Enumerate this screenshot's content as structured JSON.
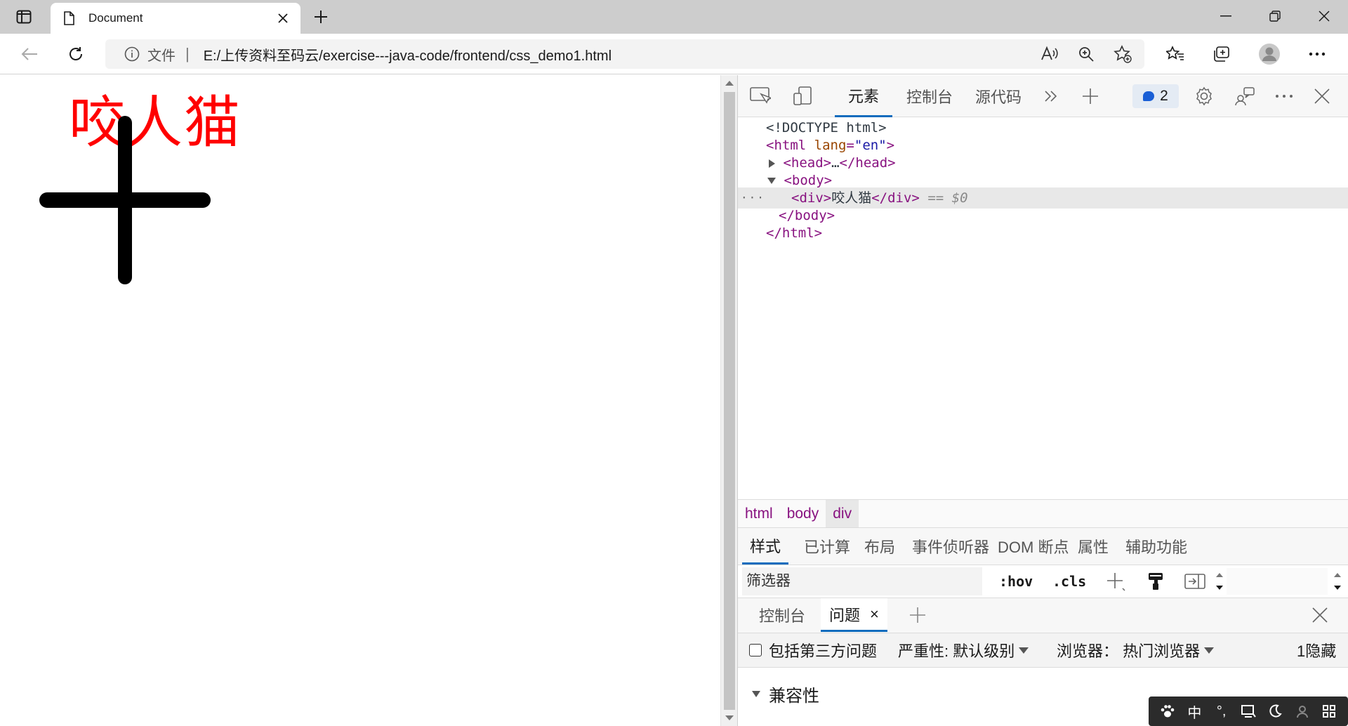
{
  "browser": {
    "tab_title": "Document",
    "address": {
      "info_label": "文件",
      "separator": "|",
      "url": "E:/上传资料至码云/exercise---java-code/frontend/css_demo1.html"
    }
  },
  "page": {
    "div_text": "咬人猫",
    "div_color": "#ff0000"
  },
  "devtools": {
    "tabs": [
      "元素",
      "控制台",
      "源代码"
    ],
    "active_tab": "元素",
    "issues_count": "2",
    "dom": {
      "doctype": "<!DOCTYPE html>",
      "html_open_tag": "<html",
      "lang_attr": "lang",
      "lang_value": "\"en\"",
      "head_open": "<head>",
      "ellipsis": "…",
      "head_close": "</head>",
      "body_open": "<body>",
      "div_open": "<div>",
      "div_text": "咬人猫",
      "div_close": "</div>",
      "selected_ref": "== $0",
      "body_close": "</body>",
      "html_close": "</html>",
      "gutter_dots": "···"
    },
    "breadcrumbs": [
      "html",
      "body",
      "div"
    ],
    "style_tabs": [
      "样式",
      "已计算",
      "布局",
      "事件侦听器",
      "DOM 断点",
      "属性",
      "辅助功能"
    ],
    "filter_placeholder": "筛选器",
    "hov_label": ":hov",
    "cls_label": ".cls",
    "drawer_tabs": [
      "控制台",
      "问题"
    ],
    "drawer_close": "×",
    "issues_toolbar": {
      "third_party_label": "包括第三方问题",
      "severity_label": "严重性: 默认级别",
      "browser_label": "浏览器： 热门浏览器",
      "hidden_label": "1隐藏"
    },
    "compat_section": "兼容性"
  },
  "ime": {
    "mode": "中",
    "punct": "°,",
    "items": [
      "paw-icon",
      "中",
      "punct-icon",
      "screen-icon",
      "moon-icon",
      "user-icon",
      "grid-icon"
    ]
  }
}
